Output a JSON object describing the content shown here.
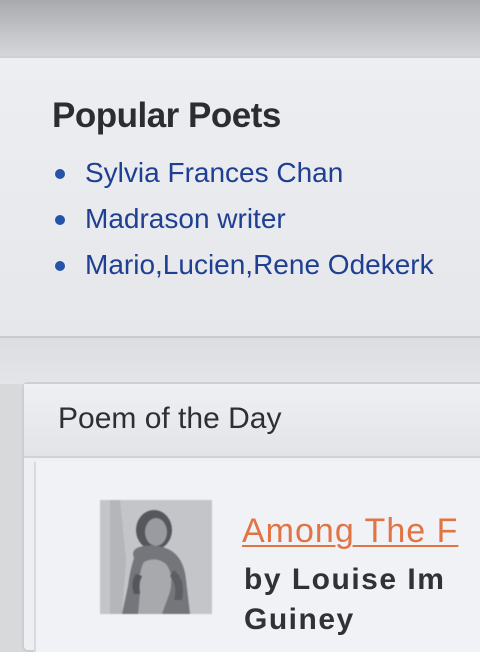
{
  "popular_poets": {
    "title": "Popular Poets",
    "items": [
      {
        "label": "Sylvia Frances Chan"
      },
      {
        "label": "Madrason writer"
      },
      {
        "label": "Mario,Lucien,Rene Odekerk"
      }
    ]
  },
  "poem_of_the_day": {
    "title": "Poem of the Day",
    "poem_title": "Among The F",
    "author_line_1": "by Louise Im",
    "author_line_2": "Guiney"
  },
  "colors": {
    "link_blue": "#1f3f92",
    "poem_link_orange": "#e07445",
    "heading": "#2c2d30"
  },
  "icons": {
    "bullet": "bullet-icon",
    "photo": "poet-portrait"
  }
}
